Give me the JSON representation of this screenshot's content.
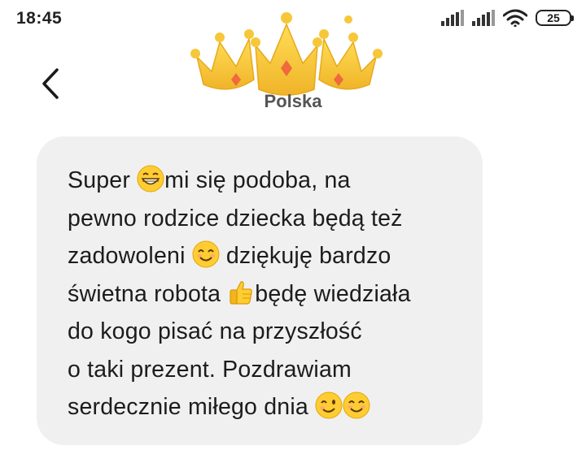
{
  "status_bar": {
    "time": "18:45",
    "battery": "25",
    "icons": [
      "signal-icon",
      "signal-icon",
      "wifi-icon",
      "battery-icon"
    ]
  },
  "header": {
    "contact_name": "Polska",
    "avatar_icon": "crown-icon",
    "back_icon": "chevron-left-icon"
  },
  "message": {
    "lines": [
      {
        "a": "Super ",
        "emoji": "grin-emoji",
        "b": "mi się podoba, na"
      },
      {
        "a": "pewno rodzice dziecka będą też"
      },
      {
        "a": "zadowoleni ",
        "emoji": "smile-emoji",
        "b": " dziękuję bardzo"
      },
      {
        "a": "świetna robota ",
        "emoji": "thumbs-up-emoji",
        "b": "będę wiedziała"
      },
      {
        "a": "do kogo pisać na przyszłość"
      },
      {
        "a": "o taki prezent. Pozdrawiam"
      },
      {
        "a": "serdecznie miłego dnia ",
        "emoji": "wink-emoji",
        "emoji2": "smile-emoji"
      }
    ]
  },
  "colors": {
    "bubble": "#f0f0f0",
    "crown": "#f7c73a",
    "gem": "#ef6a3c"
  }
}
